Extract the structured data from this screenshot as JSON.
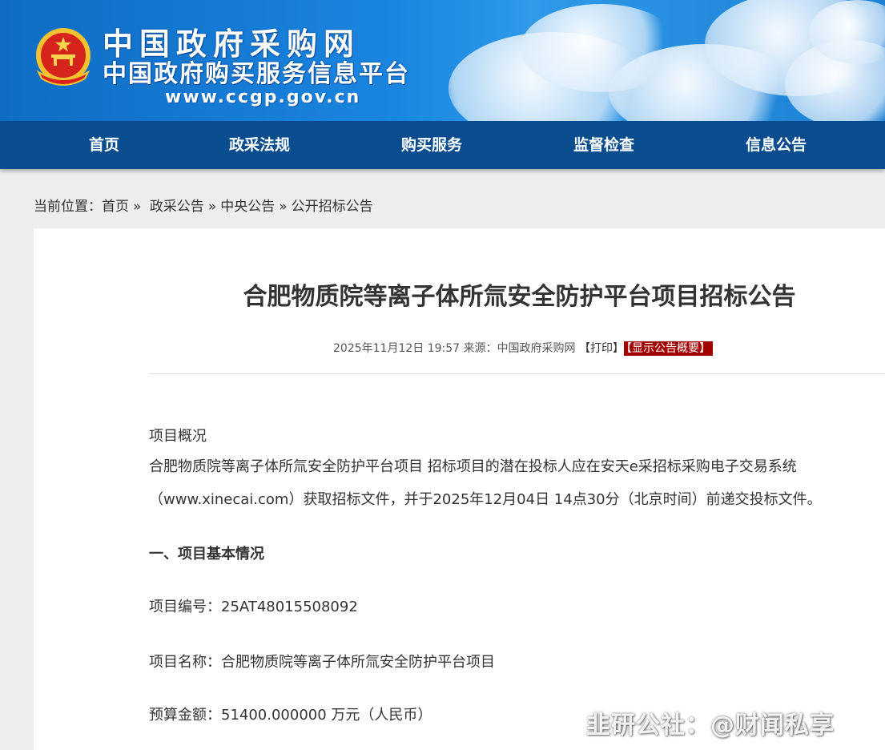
{
  "header": {
    "title": "中国政府采购网",
    "subtitle": "中国政府购买服务信息平台",
    "url": "www.ccgp.gov.cn",
    "emblem_icon": "national-emblem-icon"
  },
  "nav": {
    "items": [
      {
        "label": "首页"
      },
      {
        "label": "政采法规"
      },
      {
        "label": "购买服务"
      },
      {
        "label": "监督检查"
      },
      {
        "label": "信息公告"
      }
    ]
  },
  "breadcrumb": {
    "prefix": "当前位置：",
    "items": [
      "首页",
      "政采公告",
      "中央公告",
      "公开招标公告"
    ],
    "separator": "»"
  },
  "article": {
    "title": "合肥物质院等离子体所氚安全防护平台项目招标公告",
    "meta": {
      "datetime": "2025年11月12日 19:57",
      "source_label": "来源：",
      "source": "中国政府采购网",
      "print_label": "【打印】",
      "summary_label": "【显示公告概要】"
    },
    "overview_heading": "项目概况",
    "overview_line1": "合肥物质院等离子体所氚安全防护平台项目 招标项目的潜在投标人应在安天e采招标采购电子交易系统",
    "overview_line2": "（www.xinecai.com）获取招标文件，并于2025年12月04日 14点30分（北京时间）前递交投标文件。",
    "section1_heading": "一、项目基本情况",
    "project_no_label": "项目编号：",
    "project_no": "25AT48015508092",
    "project_name_label": "项目名称：",
    "project_name": "合肥物质院等离子体所氚安全防护平台项目",
    "budget_label": "预算金额：",
    "budget": "51400.000000 万元（人民币）"
  },
  "watermark": "韭研公社：@财闻私享",
  "colors": {
    "banner": "#1a86e0",
    "nav": "#0a4d8f",
    "summary_badge": "#a30000"
  }
}
